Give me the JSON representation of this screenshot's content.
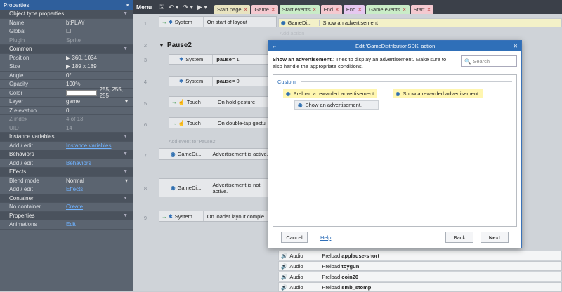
{
  "properties": {
    "title": "Properties",
    "close": "✕",
    "rows": [
      {
        "type": "sec",
        "label": "Object type properties"
      },
      {
        "k": "Name",
        "v": "btPLAY"
      },
      {
        "k": "Global",
        "v": "☐"
      },
      {
        "k": "Plugin",
        "v": "Sprite",
        "dim": true
      },
      {
        "type": "sec",
        "label": "Common"
      },
      {
        "k": "Position",
        "v": "▶ 360, 1034"
      },
      {
        "k": "Size",
        "v": "▶ 189 x 189"
      },
      {
        "k": "Angle",
        "v": "0°"
      },
      {
        "k": "Opacity",
        "v": "100%"
      },
      {
        "k": "Color",
        "v": "255, 255, 255"
      },
      {
        "k": "Layer",
        "v": "game"
      },
      {
        "k": "Z elevation",
        "v": "0"
      },
      {
        "k": "Z index",
        "v": "4 of 13",
        "dim": true
      },
      {
        "k": "UID",
        "v": "14",
        "dim": true
      },
      {
        "type": "sec",
        "label": "Instance variables"
      },
      {
        "k": "Add / edit",
        "v": "Instance variables",
        "link": true
      },
      {
        "type": "sec",
        "label": "Behaviors"
      },
      {
        "k": "Add / edit",
        "v": "Behaviors",
        "link": true
      },
      {
        "type": "sec",
        "label": "Effects"
      },
      {
        "k": "Blend mode",
        "v": "Normal"
      },
      {
        "k": "Add / edit",
        "v": "Effects",
        "link": true
      },
      {
        "type": "sec",
        "label": "Container"
      },
      {
        "k": "No container",
        "v": "Create",
        "link": true
      },
      {
        "type": "sec",
        "label": "Properties"
      },
      {
        "k": "Animations",
        "v": "Edit",
        "link": true
      }
    ]
  },
  "toolbar": {
    "menu": "Menu",
    "tabs": [
      {
        "label": "Start page",
        "color": "#e8e3c0"
      },
      {
        "label": "Game",
        "color": "#f4c9d0"
      },
      {
        "label": "Start events",
        "color": "#c9ecc7"
      },
      {
        "label": "End",
        "color": "#f4c9d0"
      },
      {
        "label": "End",
        "color": "#e6c8f0"
      },
      {
        "label": "Game events",
        "color": "#c9ecc7"
      },
      {
        "label": "Start",
        "color": "#f4c9d0"
      }
    ]
  },
  "events": {
    "e1": {
      "num": "1",
      "obj": "System",
      "cond": "On start of layout",
      "act_obj": "GameDi...",
      "act": "Show an advertisement",
      "add_action": "Add action"
    },
    "group": {
      "num": "2",
      "label": "Pause2"
    },
    "e3": {
      "num": "3",
      "obj": "System",
      "cond_b": "pause",
      "cond_r": " = 1"
    },
    "e4": {
      "num": "4",
      "obj": "System",
      "cond_b": "pause",
      "cond_r": " = 0"
    },
    "e5": {
      "num": "5",
      "obj": "Touch",
      "cond": "On hold gesture"
    },
    "e6": {
      "num": "6",
      "obj": "Touch",
      "cond": "On double-tap gestu"
    },
    "add_event": "Add event to 'Pause2'",
    "e7": {
      "num": "7",
      "obj": "GameDi...",
      "cond": "Advertisement is active."
    },
    "e8": {
      "num": "8",
      "obj": "GameDi...",
      "cond": "Advertisement is not active."
    },
    "e9": {
      "num": "9",
      "obj": "System",
      "cond": "On loader layout comple"
    },
    "audio": [
      {
        "obj": "Audio",
        "pre": "Preload ",
        "name": "applause-short"
      },
      {
        "obj": "Audio",
        "pre": "Preload ",
        "name": "toygun"
      },
      {
        "obj": "Audio",
        "pre": "Preload ",
        "name": "coin20"
      },
      {
        "obj": "Audio",
        "pre": "Preload ",
        "name": "smb_stomp"
      }
    ]
  },
  "dialog": {
    "title": "Edit 'GameDistributionSDK' action",
    "desc_bold": "Show an advertisement.",
    "desc_rest": ": Tries to display an advertisement. Make sure to also handle the appropriate conditions.",
    "search_placeholder": "Search",
    "group": "Custom",
    "items": [
      "Preload a rewarded advertisement",
      "Show a rewarded advertisement.",
      "Show an advertisement."
    ],
    "cancel": "Cancel",
    "help": "Help",
    "back": "Back",
    "next": "Next"
  }
}
